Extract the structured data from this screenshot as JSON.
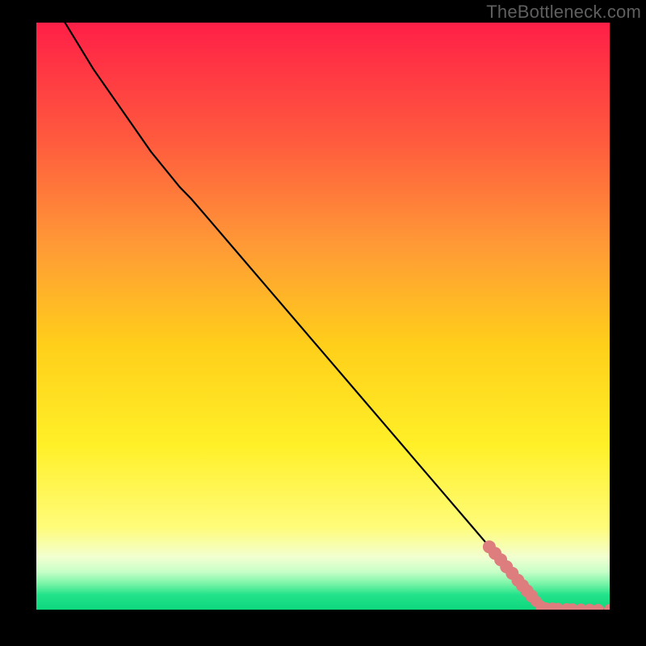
{
  "watermark": "TheBottleneck.com",
  "colors": {
    "frame_bg": "#000000",
    "gradient_top": "#ff1f47",
    "gradient_upper_mid": "#ff883c",
    "gradient_mid": "#ffd000",
    "gradient_yellow": "#ffee22",
    "gradient_pale": "#f8ffc0",
    "gradient_green": "#18e082",
    "line": "#000000",
    "marker": "#dd7d7d"
  },
  "chart_data": {
    "type": "line",
    "title": "",
    "xlabel": "",
    "ylabel": "",
    "xlim": [
      0,
      100
    ],
    "ylim": [
      0,
      100
    ],
    "series": [
      {
        "name": "curve",
        "x": [
          5,
          10,
          15,
          20,
          25,
          27,
          30,
          35,
          40,
          45,
          50,
          55,
          60,
          65,
          70,
          75,
          80,
          83,
          85,
          87,
          89,
          91,
          93,
          95,
          97,
          99,
          100
        ],
        "values": [
          100,
          92,
          85,
          78,
          72,
          70,
          66.6,
          60.9,
          55.2,
          49.5,
          43.8,
          38.1,
          32.4,
          26.7,
          21.0,
          15.3,
          9.6,
          6.2,
          3.9,
          1.5,
          0.3,
          0.1,
          0.0,
          0.0,
          0.0,
          0.0,
          0.0
        ]
      }
    ],
    "markers": {
      "name": "highlighted-points",
      "x": [
        79,
        80,
        81,
        82,
        83,
        84,
        84.8,
        85.6,
        86.4,
        87.2,
        88.0,
        88.8,
        90,
        91,
        92.5,
        93.5,
        95,
        96.5,
        98,
        100
      ],
      "values": [
        10.7,
        9.6,
        8.5,
        7.3,
        6.2,
        5.0,
        4.1,
        3.2,
        2.3,
        1.4,
        0.6,
        0.3,
        0.25,
        0.2,
        0.15,
        0.12,
        0.08,
        0.05,
        0.02,
        0.0
      ]
    }
  }
}
